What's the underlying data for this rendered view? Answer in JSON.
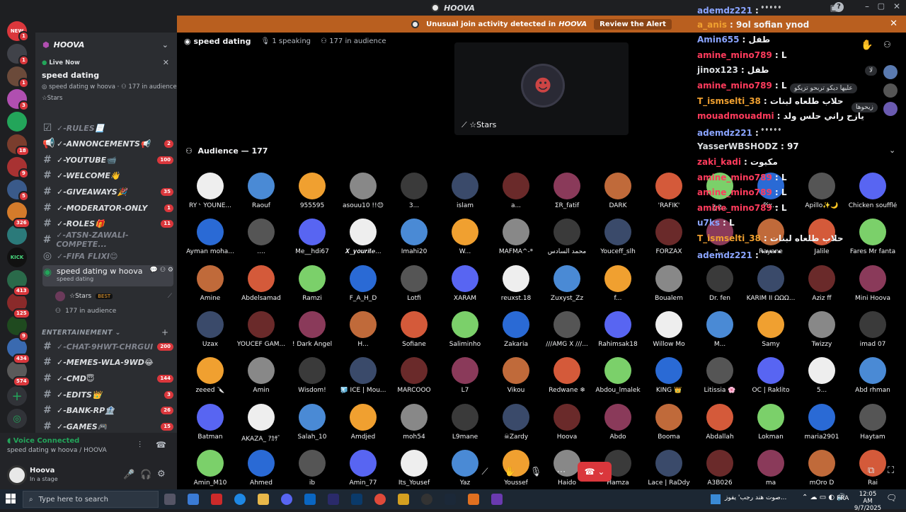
{
  "window": {
    "title": "HOOVA"
  },
  "alert": {
    "text": "Unusual join activity detected in",
    "server": "HOOVA",
    "action": "Review the Alert"
  },
  "rail": {
    "new_label": "NEW",
    "badges": [
      "1",
      "1",
      "1",
      "3",
      "18",
      "9",
      "5",
      "326",
      "413",
      "125",
      "9",
      "434",
      "574"
    ]
  },
  "sidebar": {
    "server_name": "HOOVA",
    "live": {
      "status": "Live Now",
      "title": "speed dating",
      "topic": "speed dating w hoova",
      "audience": "177 in audience",
      "speaker": "☆Stars"
    },
    "channels": [
      {
        "name": "✓-RULES📃",
        "count": ""
      },
      {
        "name": "✓-ANNONCEMENTS📢",
        "count": "2"
      },
      {
        "name": "✓-YOUTUBE📹",
        "count": "100"
      },
      {
        "name": "✓-WELCOME👋",
        "count": ""
      },
      {
        "name": "✓-GIVEAWAYS🎉",
        "count": "35"
      },
      {
        "name": "✓-MODERATOR-ONLY",
        "count": "1"
      },
      {
        "name": "✓-ROLES🎁",
        "count": "11"
      },
      {
        "name": "✓-ATSN-ZAWALI-COMPETE...",
        "count": ""
      },
      {
        "name": "✓-FIFA FLIXI😊",
        "count": ""
      }
    ],
    "stage_channel": {
      "name": "speed dating w hoova",
      "topic": "speed dating",
      "member": "☆Stars",
      "member_tag": "BEST",
      "audience": "177 in audience"
    },
    "category": "ENTERTAINEMENT",
    "channels2": [
      {
        "name": "✓-CHAT-9HWT-CHRGUI",
        "count": "200"
      },
      {
        "name": "✓-MEMES-WLA-9WD😂",
        "count": ""
      },
      {
        "name": "✓-CMD😇",
        "count": "144"
      },
      {
        "name": "✓-EDITS👑",
        "count": "3"
      },
      {
        "name": "✓-BANK-RP🏦",
        "count": "26"
      },
      {
        "name": "✓-GAMES🎮",
        "count": "15"
      }
    ]
  },
  "voice": {
    "status": "Voice Connected",
    "channel": "speed dating w hoova / HOOVA"
  },
  "user": {
    "name": "Hoova",
    "status": "In a stage"
  },
  "stage": {
    "name": "speed dating",
    "speaking": "1 speaking",
    "audience": "177 in audience",
    "speaker_name": "☆Stars",
    "audience_title": "Audience — 177"
  },
  "audience": [
    [
      "RY ᶫ YOUNE...",
      "Raouf",
      "955595",
      "asouu10 !!😊",
      "3...",
      "islam",
      "a...",
      "ΣR_fatif",
      "DARK",
      "'RAFIK'",
      "Ꙃ·Ꙅ...",
      "Pix...",
      "Apillo✨🌙",
      "Chicken soufflé"
    ],
    [
      "Ayman moha...",
      "....",
      "Me__hdi67",
      "𝑿_𝒚𝒐𝒖𝒓𝒊𝒕𝒆...",
      "Imahi20",
      "W...",
      "MAFMA^-*",
      "محمد السادس",
      "Youceff_slh",
      "FORZAX",
      "ᶰ...",
      "Rayane",
      "Jalile",
      "Fares Mr fanta"
    ],
    [
      "Amine",
      "Abdelsamad",
      "Ramzi",
      "F_A_H_D",
      "Lotfi",
      "XARAM",
      "reuxst.18",
      "Zuxyst_Zz",
      "f...",
      "Boualem",
      "Dr. fen",
      "KARIM II ΩΩΩ...",
      "Aziz ff",
      "Mini Hoova"
    ],
    [
      "Uzax",
      "YOUCEF GAM...",
      "! Dark Angel",
      "H...",
      "Sofiane",
      "Saliminho",
      "Zakaria",
      "///AMG X ///...",
      "Rahimsak18",
      "Willow Mo",
      "M...",
      "Samy",
      "Twizzy",
      "imad 07"
    ],
    [
      "zeeed 🔪",
      "Amin",
      "Wisdom!",
      "🧊 ICE | Mou...",
      "MARCOOO",
      "L7",
      "Vikou",
      "Redwane ❄",
      "Abdou_lmalek",
      "KING 👑",
      "Litissia 🌸",
      "OC | Raklito",
      "5...",
      "Abd rhman"
    ],
    [
      "Batman",
      "AKAZA_ ｱｶｻﾞ",
      "Salah_10",
      "Amdjed",
      "moh54",
      "L9mane",
      "☠Zardy",
      "Hoova",
      "Abdo",
      "Booma",
      "Abdallah",
      "Lokman",
      "maria2901",
      "Haytam"
    ],
    [
      "Amin_M10",
      "Ahmed",
      "ib",
      "Amin_77",
      "Its_Yousef",
      "Yaz",
      "Youssef",
      "Haido",
      "Hamza",
      "Lace | RaDdy",
      "A3B026",
      "ma",
      "mOro D",
      "Rai"
    ]
  ],
  "chat": [
    {
      "user": "ademdz221",
      "msg": ": ﾟﾟﾟﾟﾟ",
      "color": "#8aa4ff"
    },
    {
      "user": "a_anis",
      "msg": ": 9ol sofian ynod",
      "color": "#f0a030"
    },
    {
      "user": "Amin655",
      "msg": ": طفل",
      "color": "#8aa4ff"
    },
    {
      "user": "amine_mino789",
      "msg": ": L",
      "color": "#ff3b5c"
    },
    {
      "user": "jinox123",
      "msg": ": طفل",
      "color": "#dbdee1"
    },
    {
      "user": "amine_mino789",
      "msg": ": L",
      "color": "#ff3b5c"
    },
    {
      "user": "T_ismselti_38",
      "msg": ": حلاب طلعاه لبنات",
      "color": "#f0a030"
    },
    {
      "user": "mouadmouadmi",
      "msg": ": يازح راني حلس ولد",
      "color": "#ff3b5c"
    },
    {
      "user": "ademdz221",
      "msg": ": ﾟﾟﾟﾟﾟ",
      "color": "#8aa4ff"
    },
    {
      "user": "YasserWBSHODZ",
      "msg": ": 97",
      "color": "#dbdee1"
    },
    {
      "user": "zaki_kadi",
      "msg": ": مكبوت",
      "color": "#ff3b5c"
    },
    {
      "user": "amine_mino789",
      "msg": ": L",
      "color": "#ff3b5c"
    },
    {
      "user": "amine_mino789",
      "msg": ": L",
      "color": "#ff3b5c"
    },
    {
      "user": "amine_mino789",
      "msg": ": L",
      "color": "#ff3b5c"
    },
    {
      "user": "u7ks",
      "msg": ": L",
      "color": "#8aa4ff"
    },
    {
      "user": "T_ismselti_38",
      "msg": ": حلاب طلعاه لبنات",
      "color": "#f0a030"
    },
    {
      "user": "ademdz221",
      "msg": ": ﾟﾟﾟﾟﾟ",
      "color": "#8aa4ff"
    }
  ],
  "side_bubbles": {
    "b1": "لا",
    "b2": "عليها ديكو تربحو تزيكو",
    "b3": "زيحوها"
  },
  "taskbar": {
    "search_placeholder": "Type here to search",
    "news": "صوت هند رجب' يفوز...",
    "lang": "FRA",
    "time": "12:05 AM",
    "date": "9/7/2025",
    "notif": "2"
  },
  "colors": {
    "accent": "#5865f2",
    "danger": "#da373c",
    "alert": "#b95f1f",
    "online": "#23a55a"
  }
}
